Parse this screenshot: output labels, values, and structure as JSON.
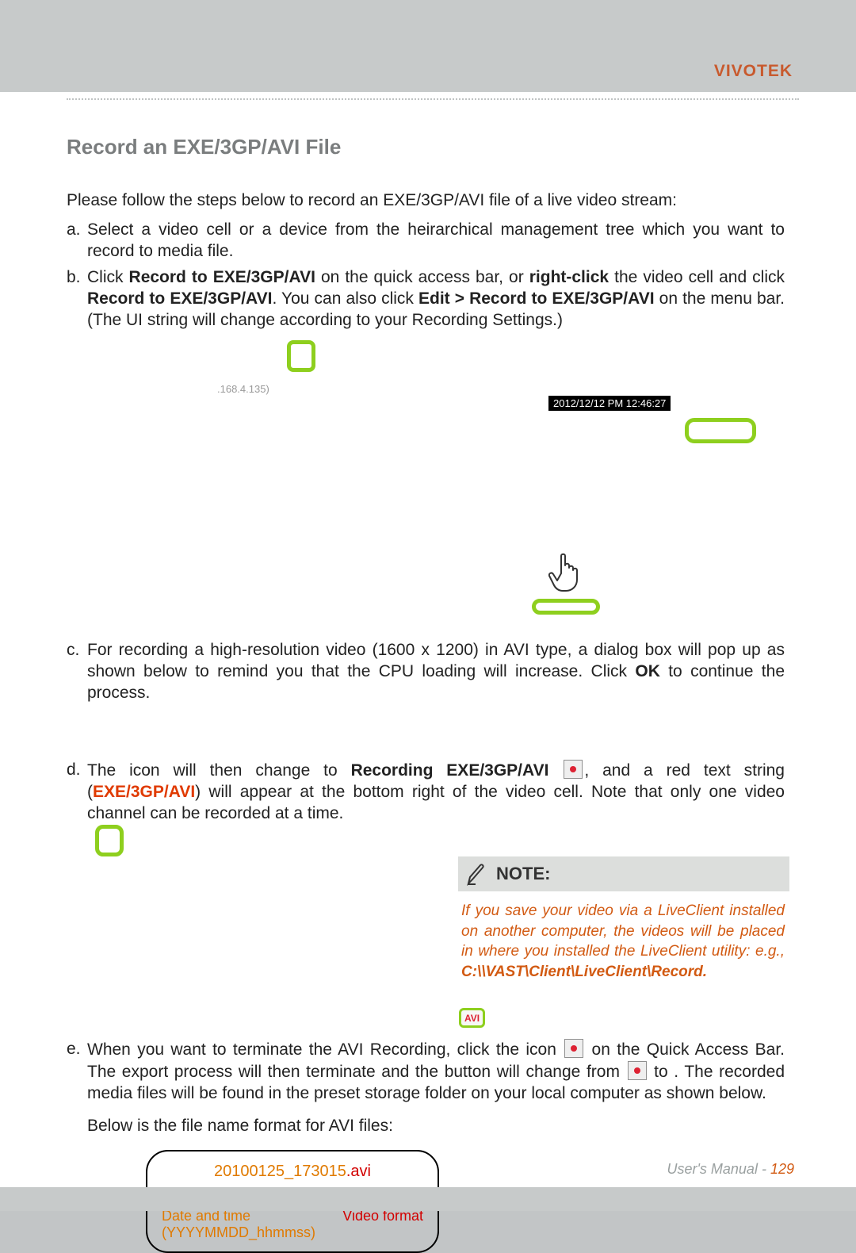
{
  "brand": "VIVOTEK",
  "section_title": "Record an EXE/3GP/AVI File",
  "intro": "Please follow the steps below to record an EXE/3GP/AVI file of a live video stream:",
  "steps": {
    "a": {
      "bullet": "a.",
      "text": "Select a video cell or a device from the heirarchical management tree which you want to record to media file."
    },
    "b": {
      "bullet": "b.",
      "pre": "Click ",
      "bold1": "Record to EXE/3GP/AVI",
      "mid1": " on the quick access bar, or ",
      "bold2": "right-click",
      "mid2": " the video cell and click ",
      "bold3": "Record to EXE/3GP/AVI",
      "mid3": ". You can also click ",
      "bold4": "Edit > Record to EXE/3GP/AVI",
      "tail": " on the menu bar. (The UI string will change according to your Recording Settings.)",
      "ip_label": ".168.4.135)",
      "timestamp": "2012/12/12 PM 12:46:27"
    },
    "c": {
      "bullet": "c.",
      "pre": "For recording a high-resolution video (1600 x 1200) in AVI type, a dialog box will pop up as shown below to remind you that the CPU loading will increase. Click ",
      "bold1": "OK",
      "tail": " to continue the process."
    },
    "d": {
      "bullet": "d.",
      "pre": "The icon       will then change to ",
      "bold1": "Recording EXE/3GP/AVI",
      "mid1": ", and a red text string (",
      "red1": "EXE/3GP/AVI",
      "mid2": ") will appear at the bottom right of the video cell. Note that only one video channel can be recorded at a time."
    },
    "e": {
      "bullet": "e.",
      "pre": "When you want to terminate the AVI Recording, click the icon ",
      "mid1": " on the Quick Access Bar. The export process will then terminate and the button will change from ",
      "mid2": " to       . The recorded media files will be found in the preset storage folder on your local computer as shown below.",
      "below_line": "Below is the file name format for AVI files:"
    }
  },
  "note": {
    "title": "NOTE:",
    "body_pre": "If you save your video via a LiveClient installed on another computer, the videos will be placed in where you installed the LiveClient utility: e.g., ",
    "body_bold": "C:\\\\VAST\\Client\\LiveClient\\Record."
  },
  "avi_badge": "AVI",
  "filename_box": {
    "date_part": "20100125_173015",
    "ext_part": ".avi",
    "arrow": "↓",
    "label_date": "Date and time",
    "label_fmt": "Video format",
    "date_sub": "(YYYYMMDD_hhmmss)"
  },
  "footer": {
    "label": "User's Manual - ",
    "page": "129"
  }
}
